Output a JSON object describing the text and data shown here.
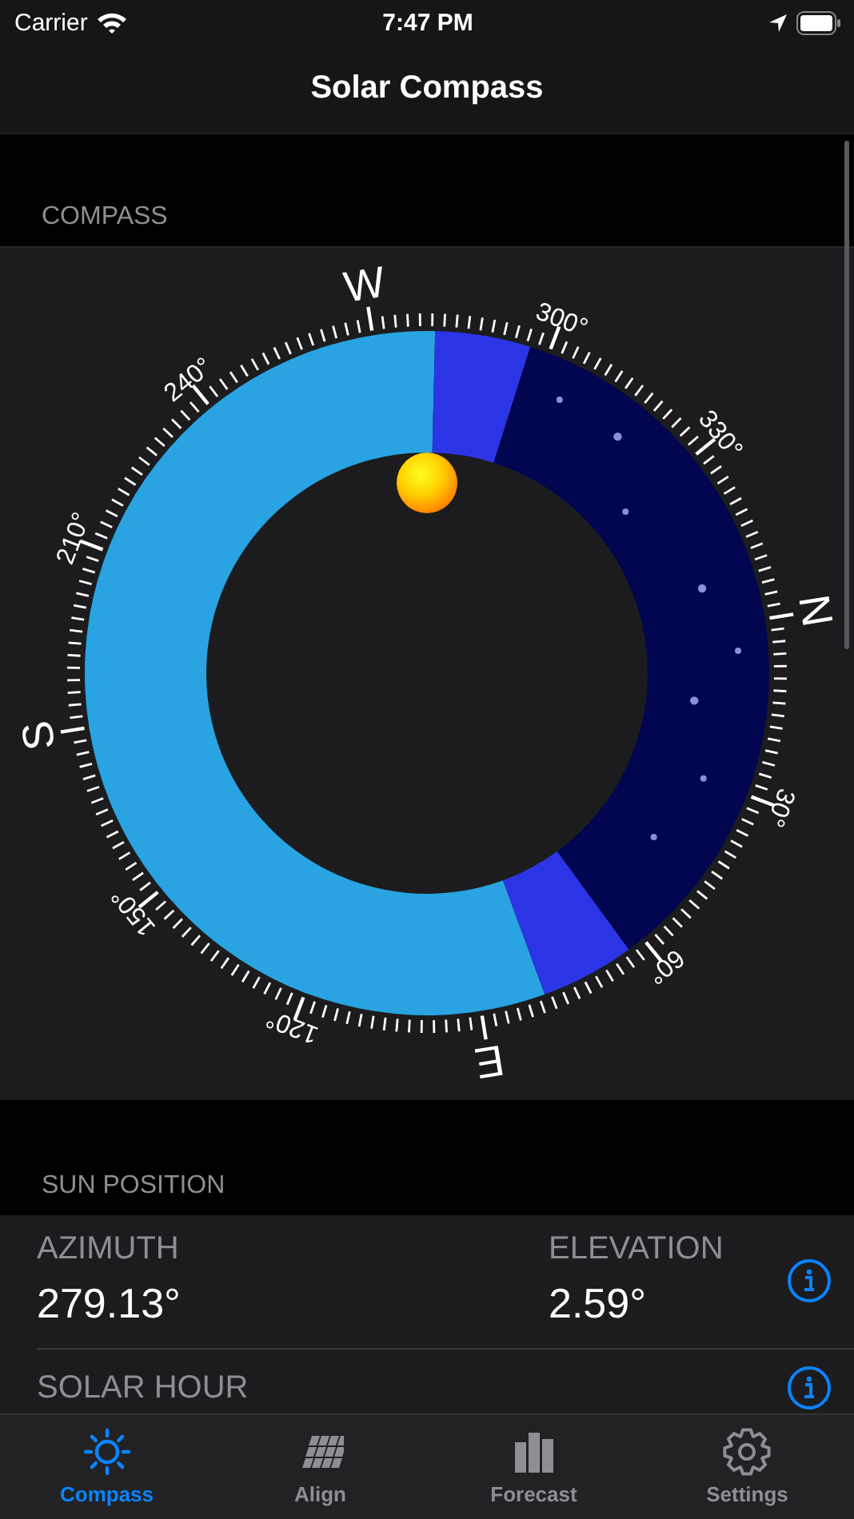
{
  "status_bar": {
    "carrier": "Carrier",
    "time": "7:47 PM"
  },
  "nav": {
    "title": "Solar Compass"
  },
  "compass": {
    "header": "COMPASS",
    "labels": [
      {
        "text": "N",
        "kind": "cardinal"
      },
      {
        "text": "30°",
        "kind": "degree"
      },
      {
        "text": "60°",
        "kind": "degree"
      },
      {
        "text": "E",
        "kind": "cardinal"
      },
      {
        "text": "120°",
        "kind": "degree"
      },
      {
        "text": "150°",
        "kind": "degree"
      },
      {
        "text": "S",
        "kind": "cardinal"
      },
      {
        "text": "210°",
        "kind": "degree"
      },
      {
        "text": "240°",
        "kind": "degree"
      },
      {
        "text": "W",
        "kind": "cardinal"
      },
      {
        "text": "300°",
        "kind": "degree"
      },
      {
        "text": "330°",
        "kind": "degree"
      }
    ]
  },
  "sun_position": {
    "header": "SUN POSITION",
    "rows": [
      {
        "fields": [
          {
            "label": "AZIMUTH",
            "value": "279.13°"
          },
          {
            "label": "ELEVATION",
            "value": "2.59°"
          }
        ]
      },
      {
        "fields": [
          {
            "label": "SOLAR HOUR"
          }
        ]
      }
    ]
  },
  "tabs": [
    {
      "label": "Compass",
      "kind": "sun",
      "selected": true
    },
    {
      "label": "Align",
      "kind": "panel",
      "selected": false
    },
    {
      "label": "Forecast",
      "kind": "bars",
      "selected": false
    },
    {
      "label": "Settings",
      "kind": "gear",
      "selected": false
    }
  ]
}
